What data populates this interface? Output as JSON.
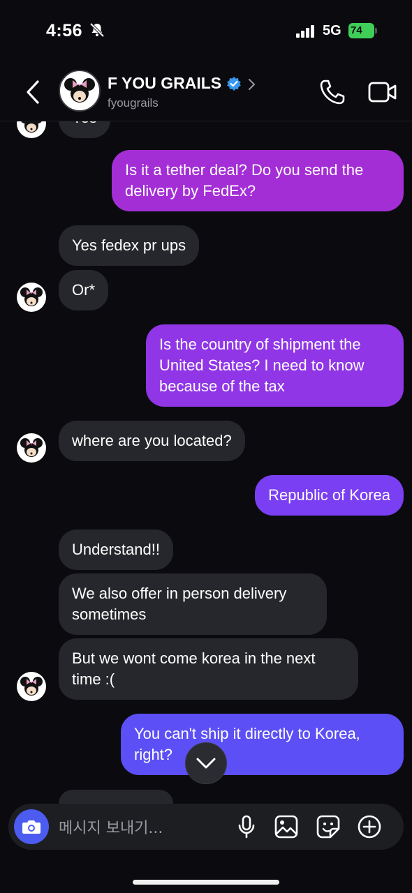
{
  "status_bar": {
    "time": "4:56",
    "network": "5G",
    "battery": "74"
  },
  "header": {
    "name": "F YOU GRAILS",
    "username": "fyougrails",
    "icons": [
      "back-icon",
      "verified-icon",
      "chevron-right-icon",
      "phone-icon",
      "video-camera-icon"
    ]
  },
  "messages": [
    {
      "side": "in",
      "text": "Yes"
    },
    {
      "side": "out",
      "text": "Is it a tether deal? Do you send the delivery by FedEx?"
    },
    {
      "side": "in",
      "text": "Yes fedex pr ups"
    },
    {
      "side": "in",
      "text": "Or*"
    },
    {
      "side": "out",
      "text": "Is the country of shipment the United States? I need to know because of the tax"
    },
    {
      "side": "in",
      "text": "where are you located?"
    },
    {
      "side": "out",
      "text": "Republic of Korea"
    },
    {
      "side": "in",
      "text": "Understand!!"
    },
    {
      "side": "in",
      "text": "We also offer in person delivery sometimes"
    },
    {
      "side": "in",
      "text": "But we wont come korea in the next time :("
    },
    {
      "side": "out",
      "text": "You can't ship it directly to Korea, right?"
    }
  ],
  "composer": {
    "placeholder": "메시지 보내기...",
    "icons": [
      "camera-icon",
      "microphone-icon",
      "gallery-icon",
      "sticker-icon",
      "plus-icon"
    ]
  },
  "colors": {
    "background": "#0b0b0f",
    "incoming_bubble": "#26272c",
    "outgoing_gradient": [
      "#a42ed6",
      "#8a3cf0",
      "#5b4ff5"
    ],
    "camera_button": "#4c5bf0"
  }
}
